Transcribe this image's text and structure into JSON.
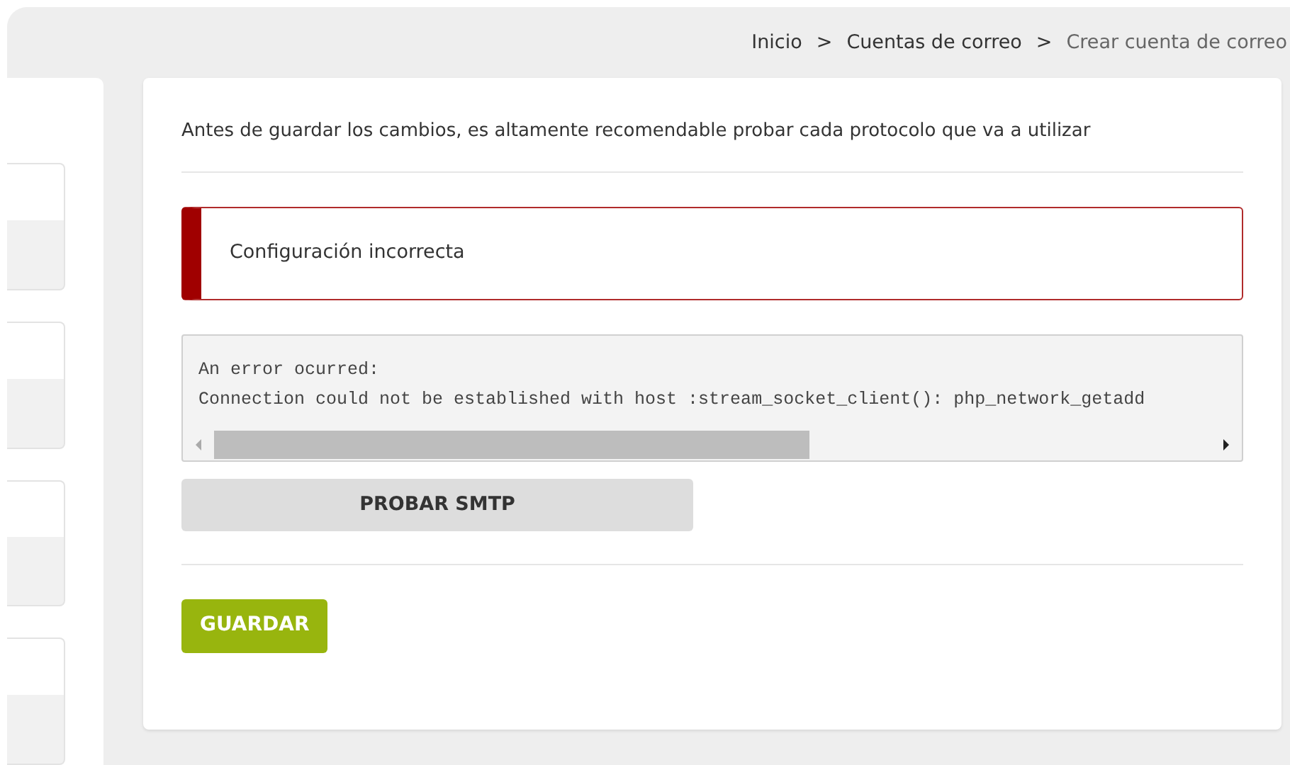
{
  "breadcrumb": [
    {
      "label": "Inicio",
      "current": false
    },
    {
      "label": "Cuentas de correo",
      "current": false
    },
    {
      "label": "Crear cuenta de correo",
      "current": true
    }
  ],
  "breadcrumb_separator": ">",
  "intro": "Antes de guardar los cambios, es altamente recomendable probar cada protocolo que va a utilizar",
  "alert": {
    "text": "Configuración incorrecta"
  },
  "log": [
    "An error ocurred:",
    "Connection could not be established with host  :stream_socket_client(): php_network_getadd"
  ],
  "test_button": "PROBAR SMTP",
  "save_button": "GUARDAR"
}
